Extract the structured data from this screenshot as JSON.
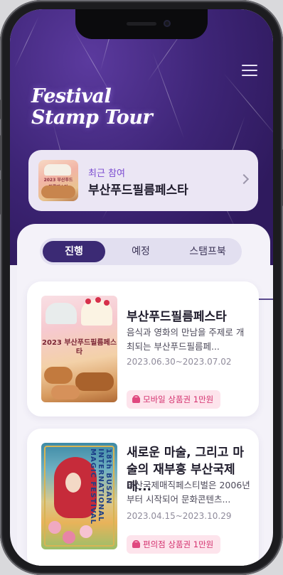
{
  "app": {
    "logo_line1": "Festival",
    "logo_line2": "Stamp Tour"
  },
  "recent": {
    "label": "최근 참여",
    "title": "부산푸드필름페스타",
    "thumb_text": "2023 부산푸드필름페스타"
  },
  "tabs": [
    {
      "label": "진행",
      "active": true
    },
    {
      "label": "예정",
      "active": false
    },
    {
      "label": "스탬프북",
      "active": false
    }
  ],
  "events": [
    {
      "title": "부산푸드필름페스타",
      "description": "음식과 영화의 만남을 주제로 개최되는 부산푸드필름페...",
      "date": "2023.06.30~2023.07.02",
      "badge": "모바일 상품권 1만원",
      "poster_text": "2023 부산푸드필름페스타"
    },
    {
      "title": "새로운 마술, 그리고 마술의 재부흥 부산국제매...",
      "description": "부산국제매직페스티벌은 2006년부터 시작되어 문화콘텐츠...",
      "date": "2023.04.15~2023.10.29",
      "badge": "편의점 상품권 1만원",
      "poster_text": "18th BUSAN INTERNATIONAL MAGIC FESTIVAL"
    }
  ],
  "colors": {
    "brand_purple": "#3b2a74",
    "badge_pink": "#d4326f",
    "accent_label": "#7a4ad0"
  }
}
